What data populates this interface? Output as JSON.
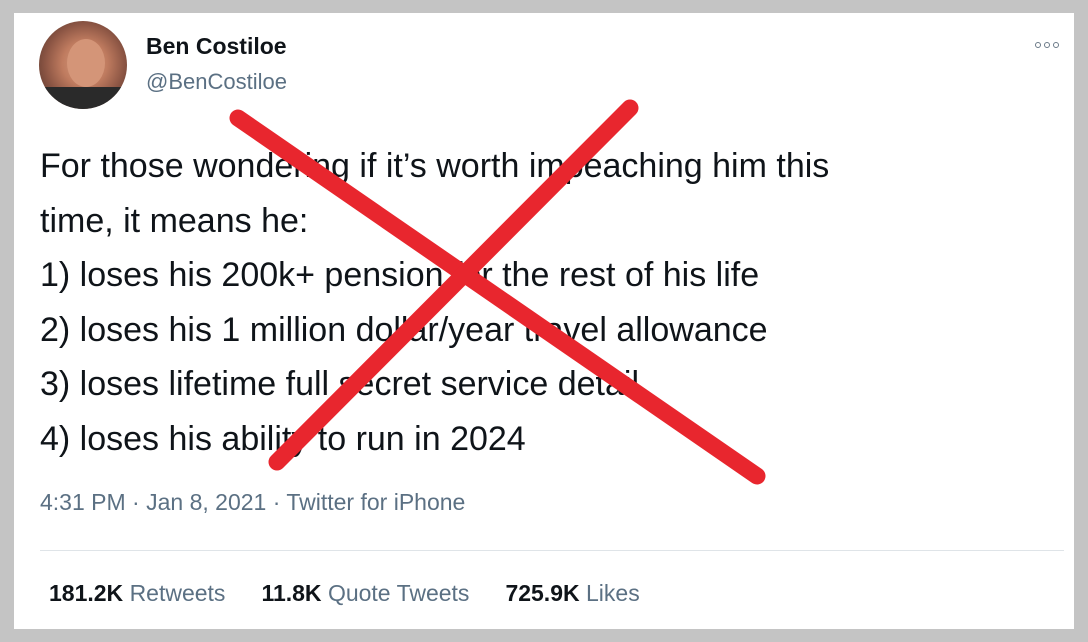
{
  "author": {
    "name": "Ben Costiloe",
    "handle": "@BenCostiloe"
  },
  "tweet": {
    "lines": [
      "For those wondering if it’s worth impeaching him this",
      "time, it means he:",
      "1) loses his 200k+ pension for the rest of his life",
      "2) loses his 1 million dollar/year travel allowance",
      "3) loses lifetime full secret service detail",
      "4) loses his ability to run in 2024"
    ],
    "time": "4:31 PM",
    "date": "Jan 8, 2021",
    "separator": "·",
    "source": "Twitter for iPhone"
  },
  "stats": {
    "retweets_count": "181.2K",
    "retweets_label": "Retweets",
    "quotes_count": "11.8K",
    "quotes_label": "Quote Tweets",
    "likes_count": "725.9K",
    "likes_label": "Likes"
  },
  "overlay": {
    "cross_color": "#e8262e"
  },
  "icons": {
    "more": "more-options-icon",
    "avatar": "profile-avatar"
  }
}
